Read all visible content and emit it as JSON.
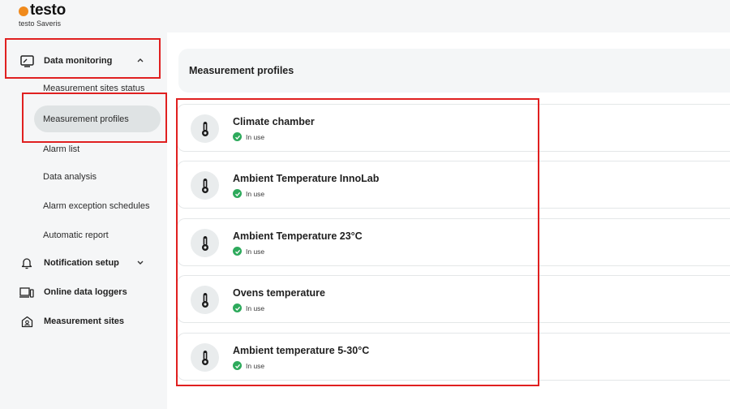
{
  "brand": {
    "name": "testo",
    "product": "testo Saveris",
    "dot_color": "#f08a1c"
  },
  "sidebar": {
    "groups": [
      {
        "label": "Data monitoring",
        "icon": "monitor-icon",
        "expanded": true
      },
      {
        "label": "Notification setup",
        "icon": "bell-icon",
        "expanded": false
      },
      {
        "label": "Online data loggers",
        "icon": "devices-icon"
      },
      {
        "label": "Measurement sites",
        "icon": "building-site-icon"
      }
    ],
    "subitems": [
      {
        "label": "Measurement sites status",
        "active": false
      },
      {
        "label": "Measurement profiles",
        "active": true
      },
      {
        "label": "Alarm list",
        "active": false
      },
      {
        "label": "Data analysis",
        "active": false
      },
      {
        "label": "Alarm exception schedules",
        "active": false
      },
      {
        "label": "Automatic report",
        "active": false
      }
    ]
  },
  "main": {
    "title": "Measurement profiles",
    "profiles": [
      {
        "name": "Climate chamber",
        "status": "In use"
      },
      {
        "name": "Ambient Temperature InnoLab",
        "status": "In use"
      },
      {
        "name": "Ambient Temperature 23°C",
        "status": "In use"
      },
      {
        "name": "Ovens temperature",
        "status": "In use"
      },
      {
        "name": "Ambient temperature 5-30°C",
        "status": "In use"
      }
    ]
  },
  "colors": {
    "highlight": "#e02020",
    "status_ok": "#2eaa5c",
    "active_bg": "#dfe3e4"
  }
}
